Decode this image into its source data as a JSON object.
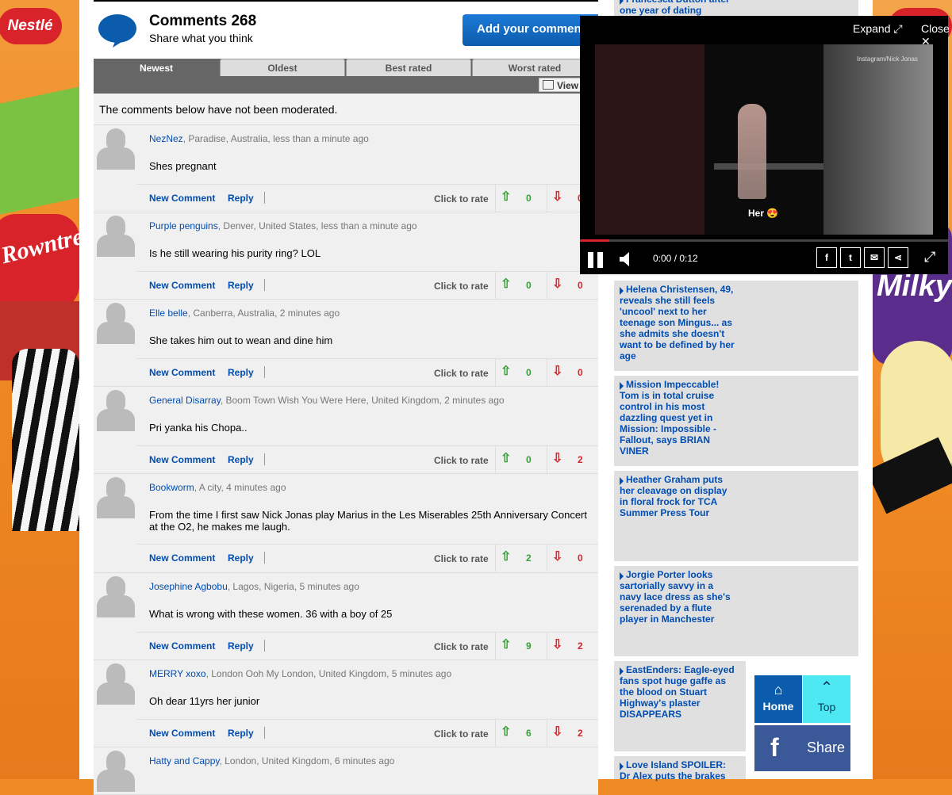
{
  "comments_header": {
    "title": "Comments 268",
    "subtitle": "Share what you think",
    "add_button": "Add your comment"
  },
  "tabs": [
    {
      "label": "Newest",
      "active": true
    },
    {
      "label": "Oldest",
      "active": false
    },
    {
      "label": "Best rated",
      "active": false
    },
    {
      "label": "Worst rated",
      "active": false
    }
  ],
  "view_button": "View",
  "notice": "The comments below have not been moderated.",
  "comment_actions": {
    "new_comment": "New Comment",
    "reply": "Reply",
    "rate": "Click to rate"
  },
  "comments": [
    {
      "name": "NezNez",
      "meta": ", Paradise, Australia, less than a minute ago",
      "text": "Shes pregnant",
      "up": "0",
      "down": "0"
    },
    {
      "name": "Purple penguins",
      "meta": ", Denver, United States, less than a minute ago",
      "text": "Is he still wearing his purity ring? LOL",
      "up": "0",
      "down": "0"
    },
    {
      "name": "Elle belle",
      "meta": ", Canberra, Australia, 2 minutes ago",
      "text": "She takes him out to wean and dine him",
      "up": "0",
      "down": "0"
    },
    {
      "name": "General Disarray",
      "meta": ", Boom Town Wish You Were Here, United Kingdom, 2 minutes ago",
      "text": "Pri yanka his Chopa..",
      "up": "0",
      "down": "2"
    },
    {
      "name": "Bookworm",
      "meta": ", A city, 4 minutes ago",
      "text": "From the time I first saw Nick Jonas play Marius in the Les Miserables 25th Anniversary Concert at the O2, he makes me laugh.",
      "up": "2",
      "down": "0"
    },
    {
      "name": "Josephine Agbobu",
      "meta": ", Lagos, Nigeria, 5 minutes ago",
      "text": "What is wrong with these women. 36 with a boy of 25",
      "up": "9",
      "down": "2"
    },
    {
      "name": "MERRY xoxo",
      "meta": ", London Ooh My London, United Kingdom, 5 minutes ago",
      "text": "Oh dear 11yrs her junior",
      "up": "6",
      "down": "2"
    },
    {
      "name": "Hatty and Cappy",
      "meta": ", London, United Kingdom, 6 minutes ago",
      "text": "",
      "up": "",
      "down": ""
    }
  ],
  "right_column": [
    {
      "text": "Francesca Dutton after one year of dating"
    },
    {
      "text": "Helena Christensen, 49, reveals she still feels 'uncool' next to her teenage son Mingus... as she admits she doesn't want to be defined by her age"
    },
    {
      "text": "Mission Impeccable! Tom is in total cruise control in his most dazzling quest yet in Mission: Impossible - Fallout, says BRIAN VINER"
    },
    {
      "text": "Heather Graham puts her cleavage on display in floral frock for TCA Summer Press Tour"
    },
    {
      "text": "Jorgie Porter looks sartorially savvy in a navy lace dress as she's serenaded by a flute player in Manchester"
    },
    {
      "text": "EastEnders: Eagle-eyed fans spot huge gaffe as the blood on Stuart Highway's plaster DISAPPEARS"
    },
    {
      "text": "Love Island SPOILER: Dr Alex puts the brakes"
    }
  ],
  "video": {
    "expand": "Expand",
    "close": "Close",
    "credit": "Instagram/Nick Jonas",
    "caption": "Her 😍",
    "time": "0:00 / 0:12",
    "progress": 0.08,
    "social": [
      "f",
      "t",
      "✉",
      "⋖"
    ]
  },
  "nav_widget": {
    "home": "Home",
    "top": "Top",
    "share": "Share"
  },
  "ads": {
    "left_brand": "Nestlé",
    "left_product": "Rowntree's",
    "right_product": "Milky"
  },
  "colors": {
    "link_blue": "#004db3",
    "up_green": "#3a9d3a",
    "down_red": "#d8232a",
    "facebook": "#3b5998"
  }
}
